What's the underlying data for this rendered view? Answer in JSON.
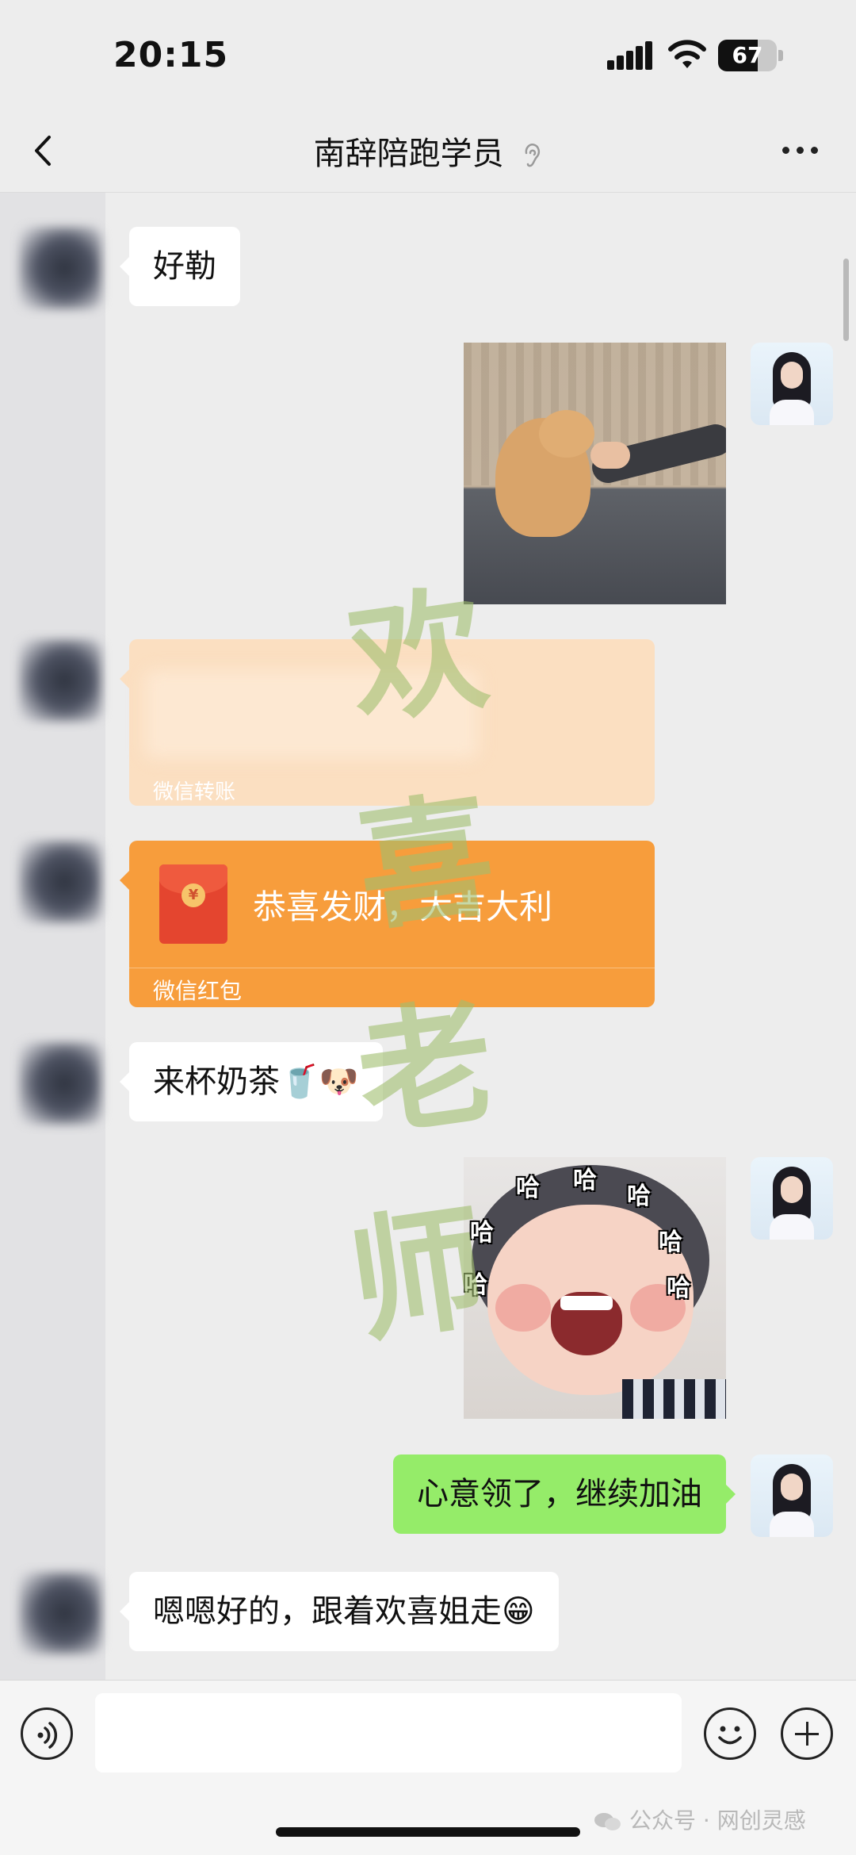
{
  "status_bar": {
    "time": "20:15",
    "battery": "67",
    "battery_level": 0.67
  },
  "nav": {
    "title": "南辞陪跑学员"
  },
  "messages": {
    "m1": "好勒",
    "transfer_label": "微信转账",
    "redpacket_title": "恭喜发财，大吉大利",
    "redpacket_label": "微信红包",
    "redpacket_coin": "¥",
    "m4": "来杯奶茶🥤🐶",
    "m5": "心意领了，继续加油",
    "m6": "嗯嗯好的，跟着欢喜姐走😁"
  },
  "sticker": {
    "haha": "哈"
  },
  "watermark": [
    "欢",
    "喜",
    "老",
    "师"
  ],
  "footer": {
    "mark": "公众号 · 网创灵感"
  },
  "icons": [
    "back-icon",
    "ear-icon",
    "more-icon",
    "voice-icon",
    "emoji-icon",
    "plus-icon",
    "wechat-icon",
    "signal-icon",
    "wifi-icon",
    "battery-icon"
  ],
  "colors": {
    "bubble_me": "#95ec69",
    "redpacket": "#f79d3c",
    "background": "#ededed"
  }
}
